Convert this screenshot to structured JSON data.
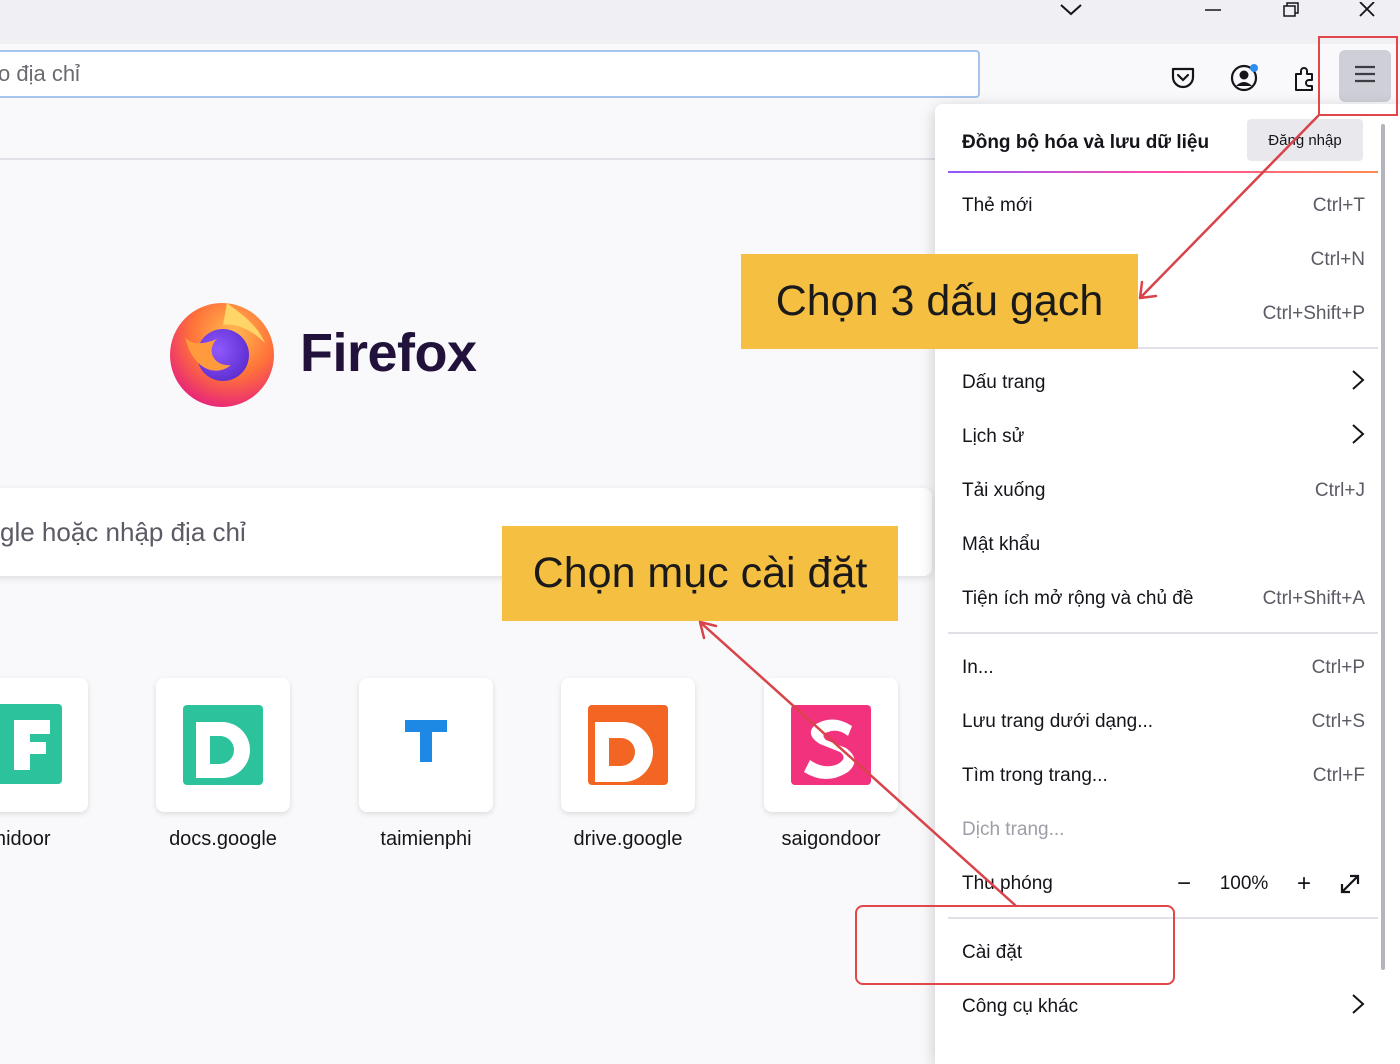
{
  "toolbar": {
    "url_placeholder": "o địa chỉ"
  },
  "newtab": {
    "logo_text": "Firefox",
    "search_placeholder": "gle hoặc nhập địa chỉ",
    "shortcuts": [
      {
        "label": "midoor",
        "color": "#2bc29c",
        "letter": "F"
      },
      {
        "label": "docs.google",
        "color": "#2bc29c",
        "letter": "D"
      },
      {
        "label": "taimienphi",
        "color": "#1e88e5",
        "letter": "T"
      },
      {
        "label": "drive.google",
        "color": "#f26522",
        "letter": "D"
      },
      {
        "label": "saigondoor",
        "color": "#f2327d",
        "letter": "S"
      }
    ]
  },
  "menu": {
    "header": "Đồng bộ hóa và lưu dữ liệu",
    "signin": "Đăng nhập",
    "items": [
      {
        "label": "Thẻ mới",
        "shortcut": "Ctrl+T"
      },
      {
        "label": "",
        "shortcut": "Ctrl+N"
      },
      {
        "label": "",
        "shortcut": "Ctrl+Shift+P"
      },
      {
        "label": "Dấu trang",
        "shortcut": ""
      },
      {
        "label": "Lịch sử",
        "shortcut": ""
      },
      {
        "label": "Tải xuống",
        "shortcut": "Ctrl+J"
      },
      {
        "label": "Mật khẩu",
        "shortcut": ""
      },
      {
        "label": "Tiện ích mở rộng và chủ đề",
        "shortcut": "Ctrl+Shift+A"
      },
      {
        "label": "In...",
        "shortcut": "Ctrl+P"
      },
      {
        "label": "Lưu trang dưới dạng...",
        "shortcut": "Ctrl+S"
      },
      {
        "label": "Tìm trong trang...",
        "shortcut": "Ctrl+F"
      },
      {
        "label": "Dịch trang...",
        "shortcut": ""
      },
      {
        "label": "Thu phóng",
        "shortcut": ""
      },
      {
        "label": "Cài đặt",
        "shortcut": ""
      },
      {
        "label": "Công cụ khác",
        "shortcut": ""
      }
    ],
    "zoom": {
      "minus": "−",
      "value": "100%",
      "plus": "+"
    }
  },
  "annotations": {
    "callout_menu": "Chọn 3 dấu gạch",
    "callout_settings": "Chọn mục cài đặt",
    "highlight_color": "#e0464a",
    "callout_color": "#f5bf42"
  }
}
